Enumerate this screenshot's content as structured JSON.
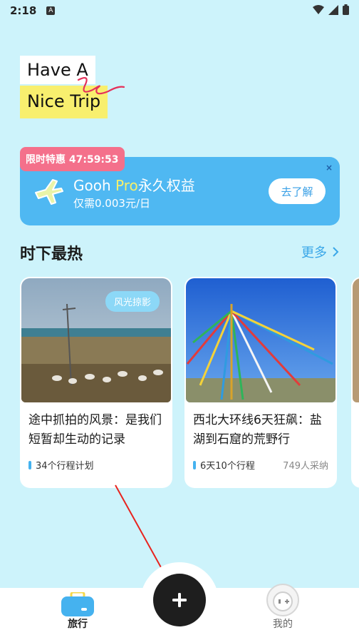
{
  "status": {
    "time": "2:18",
    "indicator": "A"
  },
  "logo": {
    "line1": "Have A",
    "line2": "Nice Trip"
  },
  "promo": {
    "badge": "限时特惠 47:59:53",
    "title_prefix": "Gooh ",
    "title_pro": "Pro",
    "title_suffix": "永久权益",
    "subtitle": "仅需0.003元/日",
    "button": "去了解",
    "close": "×"
  },
  "section": {
    "title": "时下最热",
    "more": "更多"
  },
  "cards": [
    {
      "tag": "风光掠影",
      "title": "途中抓拍的风景：是我们短暂却生动的记录",
      "meta": "34个行程计划",
      "extra": ""
    },
    {
      "tag": "",
      "title": "西北大环线6天狂飙：盐湖到石窟的荒野行",
      "meta": "6天10个行程",
      "extra": "749人采纳"
    }
  ],
  "tabs": {
    "travel": "旅行",
    "mine": "我的",
    "add": "+"
  },
  "colors": {
    "background": "#cdf3fb",
    "accent": "#4fb8f2",
    "badge": "#f4708b",
    "highlight": "#f8ef6e"
  }
}
